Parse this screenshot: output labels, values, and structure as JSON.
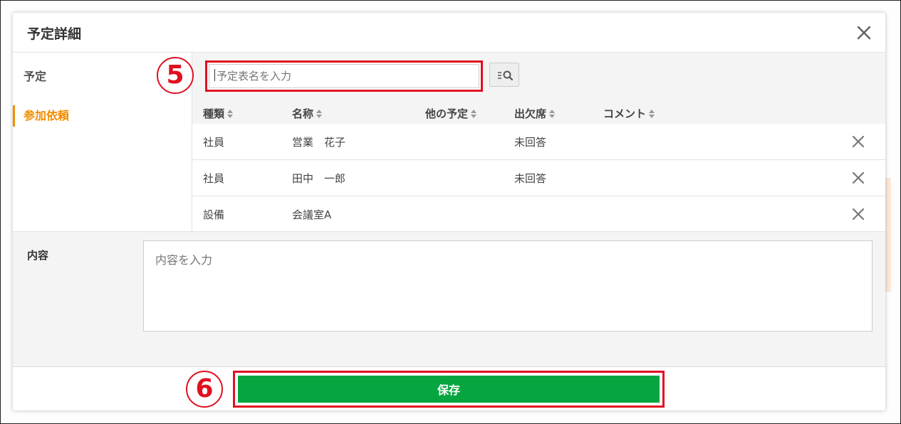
{
  "dialog": {
    "title": "予定詳細",
    "close_icon": "close-icon"
  },
  "sidebar": {
    "items": [
      {
        "label": "予定",
        "active": false
      },
      {
        "label": "参加依頼",
        "active": true
      }
    ],
    "active_color": "#f08c00"
  },
  "search": {
    "placeholder": "予定表名を入力",
    "value": "",
    "button_icon": "list-search-icon"
  },
  "markers": {
    "search": "5",
    "save": "6",
    "color": "#e01020"
  },
  "table": {
    "columns": [
      "種類",
      "名称",
      "他の予定",
      "出欠席",
      "コメント"
    ],
    "sort_icon": "sort-icon",
    "rows": [
      {
        "type": "社員",
        "name": "営業　花子",
        "other": "",
        "attendance": "未回答",
        "comment": ""
      },
      {
        "type": "社員",
        "name": "田中　一郎",
        "other": "",
        "attendance": "未回答",
        "comment": ""
      },
      {
        "type": "設備",
        "name": "会議室A",
        "other": "",
        "attendance": "",
        "comment": ""
      }
    ]
  },
  "memo": {
    "label": "内容",
    "placeholder": "内容を入力"
  },
  "footer": {
    "save_label": "保存",
    "save_color": "#07a540"
  }
}
